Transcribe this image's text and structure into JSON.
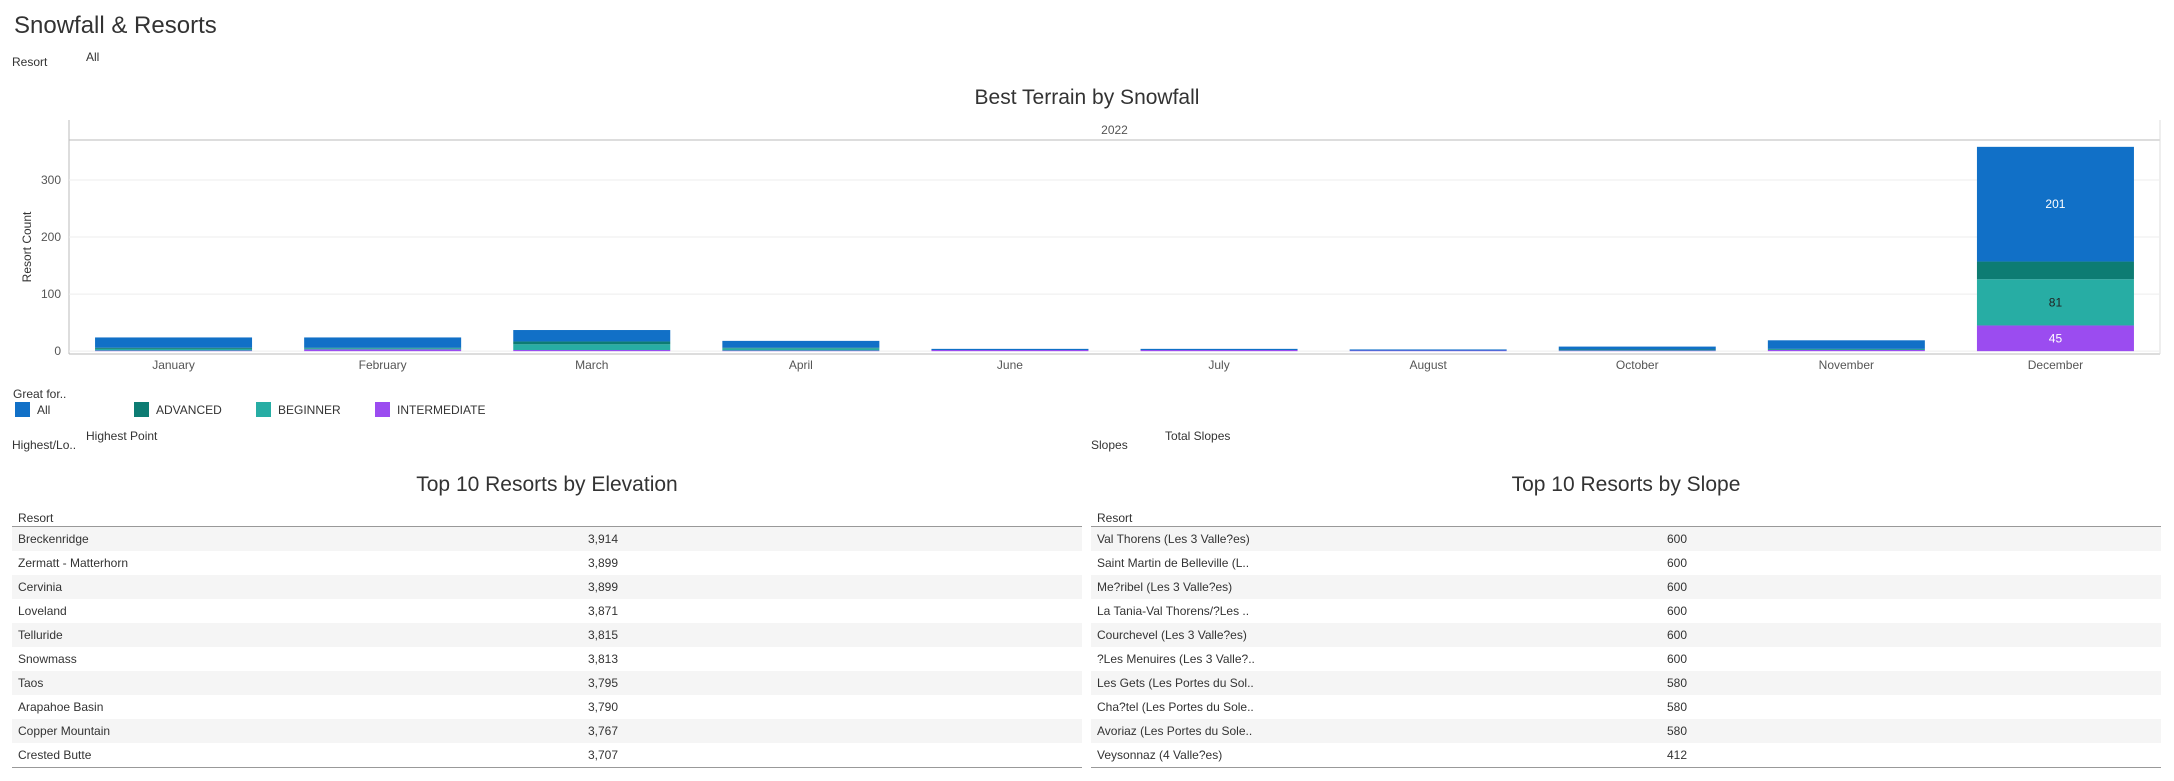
{
  "page_title": "Snowfall & Resorts",
  "filters": {
    "resort_label": "Resort",
    "resort_value": "All",
    "highest_label": "Highest/Lo..",
    "highest_value": "Highest Point",
    "slopes_label": "Slopes",
    "slopes_value": "Total Slopes"
  },
  "legend": {
    "title": "Great for..",
    "items": [
      {
        "label": "All",
        "color": "#1170c7"
      },
      {
        "label": "ADVANCED",
        "color": "#0d7c73"
      },
      {
        "label": "BEGINNER",
        "color": "#27ada4"
      },
      {
        "label": "INTERMEDIATE",
        "color": "#9b4cf0"
      }
    ]
  },
  "chart_data": {
    "type": "bar",
    "stacked": true,
    "title": "Best Terrain by Snowfall",
    "column_header": "2022",
    "ylabel": "Resort Count",
    "ylim": [
      -5,
      370
    ],
    "yticks": [
      0,
      100,
      200,
      300
    ],
    "categories": [
      "January",
      "February",
      "March",
      "April",
      "June",
      "July",
      "August",
      "October",
      "November",
      "December"
    ],
    "series": [
      {
        "name": "INTERMEDIATE",
        "color": "#9b4cf0",
        "values": [
          1,
          3,
          2,
          1,
          2,
          2,
          1,
          1,
          2,
          45
        ]
      },
      {
        "name": "BEGINNER",
        "color": "#27ada4",
        "values": [
          3,
          2,
          10,
          4,
          0,
          0,
          0,
          1,
          1,
          81
        ]
      },
      {
        "name": "ADVANCED",
        "color": "#0d7c73",
        "values": [
          2,
          1,
          5,
          1,
          0,
          0,
          0,
          1,
          1,
          31
        ]
      },
      {
        "name": "All",
        "color": "#1170c7",
        "values": [
          18,
          18,
          20,
          12,
          2,
          2,
          2,
          5,
          15,
          201
        ]
      }
    ],
    "data_labels": [
      {
        "category": "December",
        "series": "All",
        "value": "201"
      },
      {
        "category": "December",
        "series": "BEGINNER",
        "value": "81"
      },
      {
        "category": "December",
        "series": "INTERMEDIATE",
        "value": "45"
      }
    ]
  },
  "elevation_table": {
    "title": "Top 10 Resorts by Elevation",
    "column": "Resort",
    "rows": [
      {
        "resort": "Breckenridge",
        "value": "3,914"
      },
      {
        "resort": "Zermatt - Matterhorn",
        "value": "3,899"
      },
      {
        "resort": "Cervinia",
        "value": "3,899"
      },
      {
        "resort": "Loveland",
        "value": "3,871"
      },
      {
        "resort": "Telluride",
        "value": "3,815"
      },
      {
        "resort": "Snowmass",
        "value": "3,813"
      },
      {
        "resort": "Taos",
        "value": "3,795"
      },
      {
        "resort": "Arapahoe Basin",
        "value": "3,790"
      },
      {
        "resort": "Copper Mountain",
        "value": "3,767"
      },
      {
        "resort": "Crested Butte",
        "value": "3,707"
      }
    ]
  },
  "slope_table": {
    "title": "Top 10 Resorts by Slope",
    "column": "Resort",
    "rows": [
      {
        "resort": "Val Thorens (Les 3 Valle?es)",
        "value": "600"
      },
      {
        "resort": "Saint Martin de Belleville (L..",
        "value": "600"
      },
      {
        "resort": "Me?ribel (Les 3 Valle?es)",
        "value": "600"
      },
      {
        "resort": "La Tania-Val Thorens/?Les ..",
        "value": "600"
      },
      {
        "resort": "Courchevel (Les 3 Valle?es)",
        "value": "600"
      },
      {
        "resort": "?Les Menuires (Les 3 Valle?..",
        "value": "600"
      },
      {
        "resort": "Les Gets (Les Portes du Sol..",
        "value": "580"
      },
      {
        "resort": "Cha?tel (Les Portes du Sole..",
        "value": "580"
      },
      {
        "resort": "Avoriaz (Les Portes du Sole..",
        "value": "580"
      },
      {
        "resort": "Veysonnaz (4 Valle?es)",
        "value": "412"
      }
    ]
  }
}
